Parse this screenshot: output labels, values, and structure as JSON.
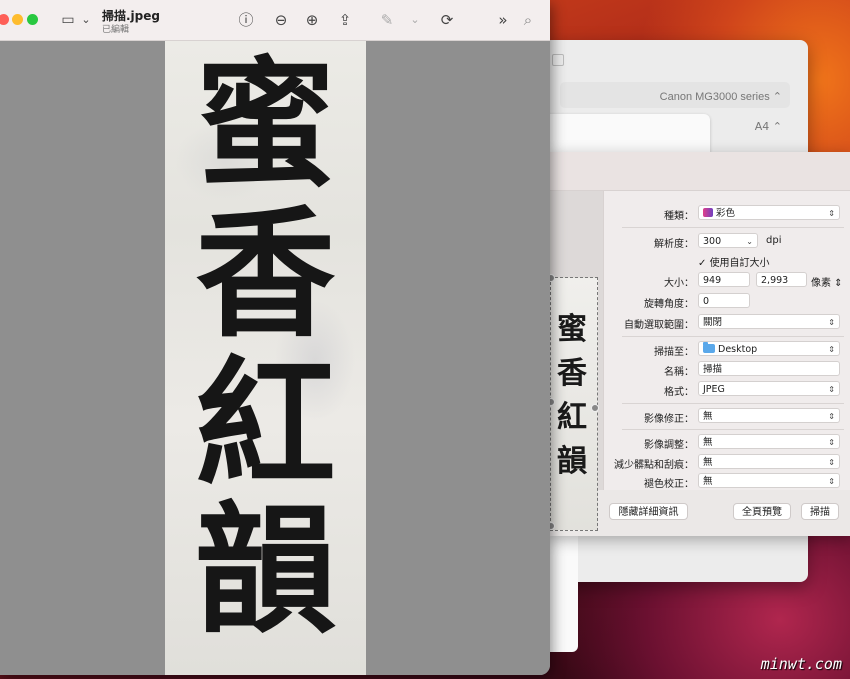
{
  "preview": {
    "doc_title": "掃描.jpeg",
    "doc_subtitle": "已編輯",
    "calligraphy": [
      "蜜",
      "香",
      "紅",
      "韻"
    ]
  },
  "printer_window": {
    "printer_name": "Canon MG3000 series",
    "paper_size": "A4"
  },
  "scan_settings": {
    "kind_label": "種類：",
    "kind_value": "彩色",
    "resolution_label": "解析度：",
    "resolution_value": "300",
    "resolution_unit": "dpi",
    "custom_size_label": "使用自訂大小",
    "size_label": "大小：",
    "width_value": "949",
    "height_value": "2,993",
    "size_unit": "像素",
    "rotation_label": "旋轉角度：",
    "rotation_value": "0",
    "auto_select_label": "自動選取範圍：",
    "auto_select_value": "關閉",
    "scan_to_label": "掃描至：",
    "scan_to_value": "Desktop",
    "name_label": "名稱：",
    "name_value": "掃描",
    "format_label": "格式：",
    "format_value": "JPEG",
    "correction_label": "影像修正：",
    "correction_value": "無",
    "adjust_label": "影像調整：",
    "adjust_value": "無",
    "dust_label": "減少髒點和刮痕：",
    "dust_value": "無",
    "color_correct_label": "褪色校正：",
    "color_correct_value": "無",
    "hide_details_button": "隱藏詳細資訊",
    "overview_button": "全頁預覽",
    "scan_button": "掃描"
  },
  "watermark": "minwt.com"
}
